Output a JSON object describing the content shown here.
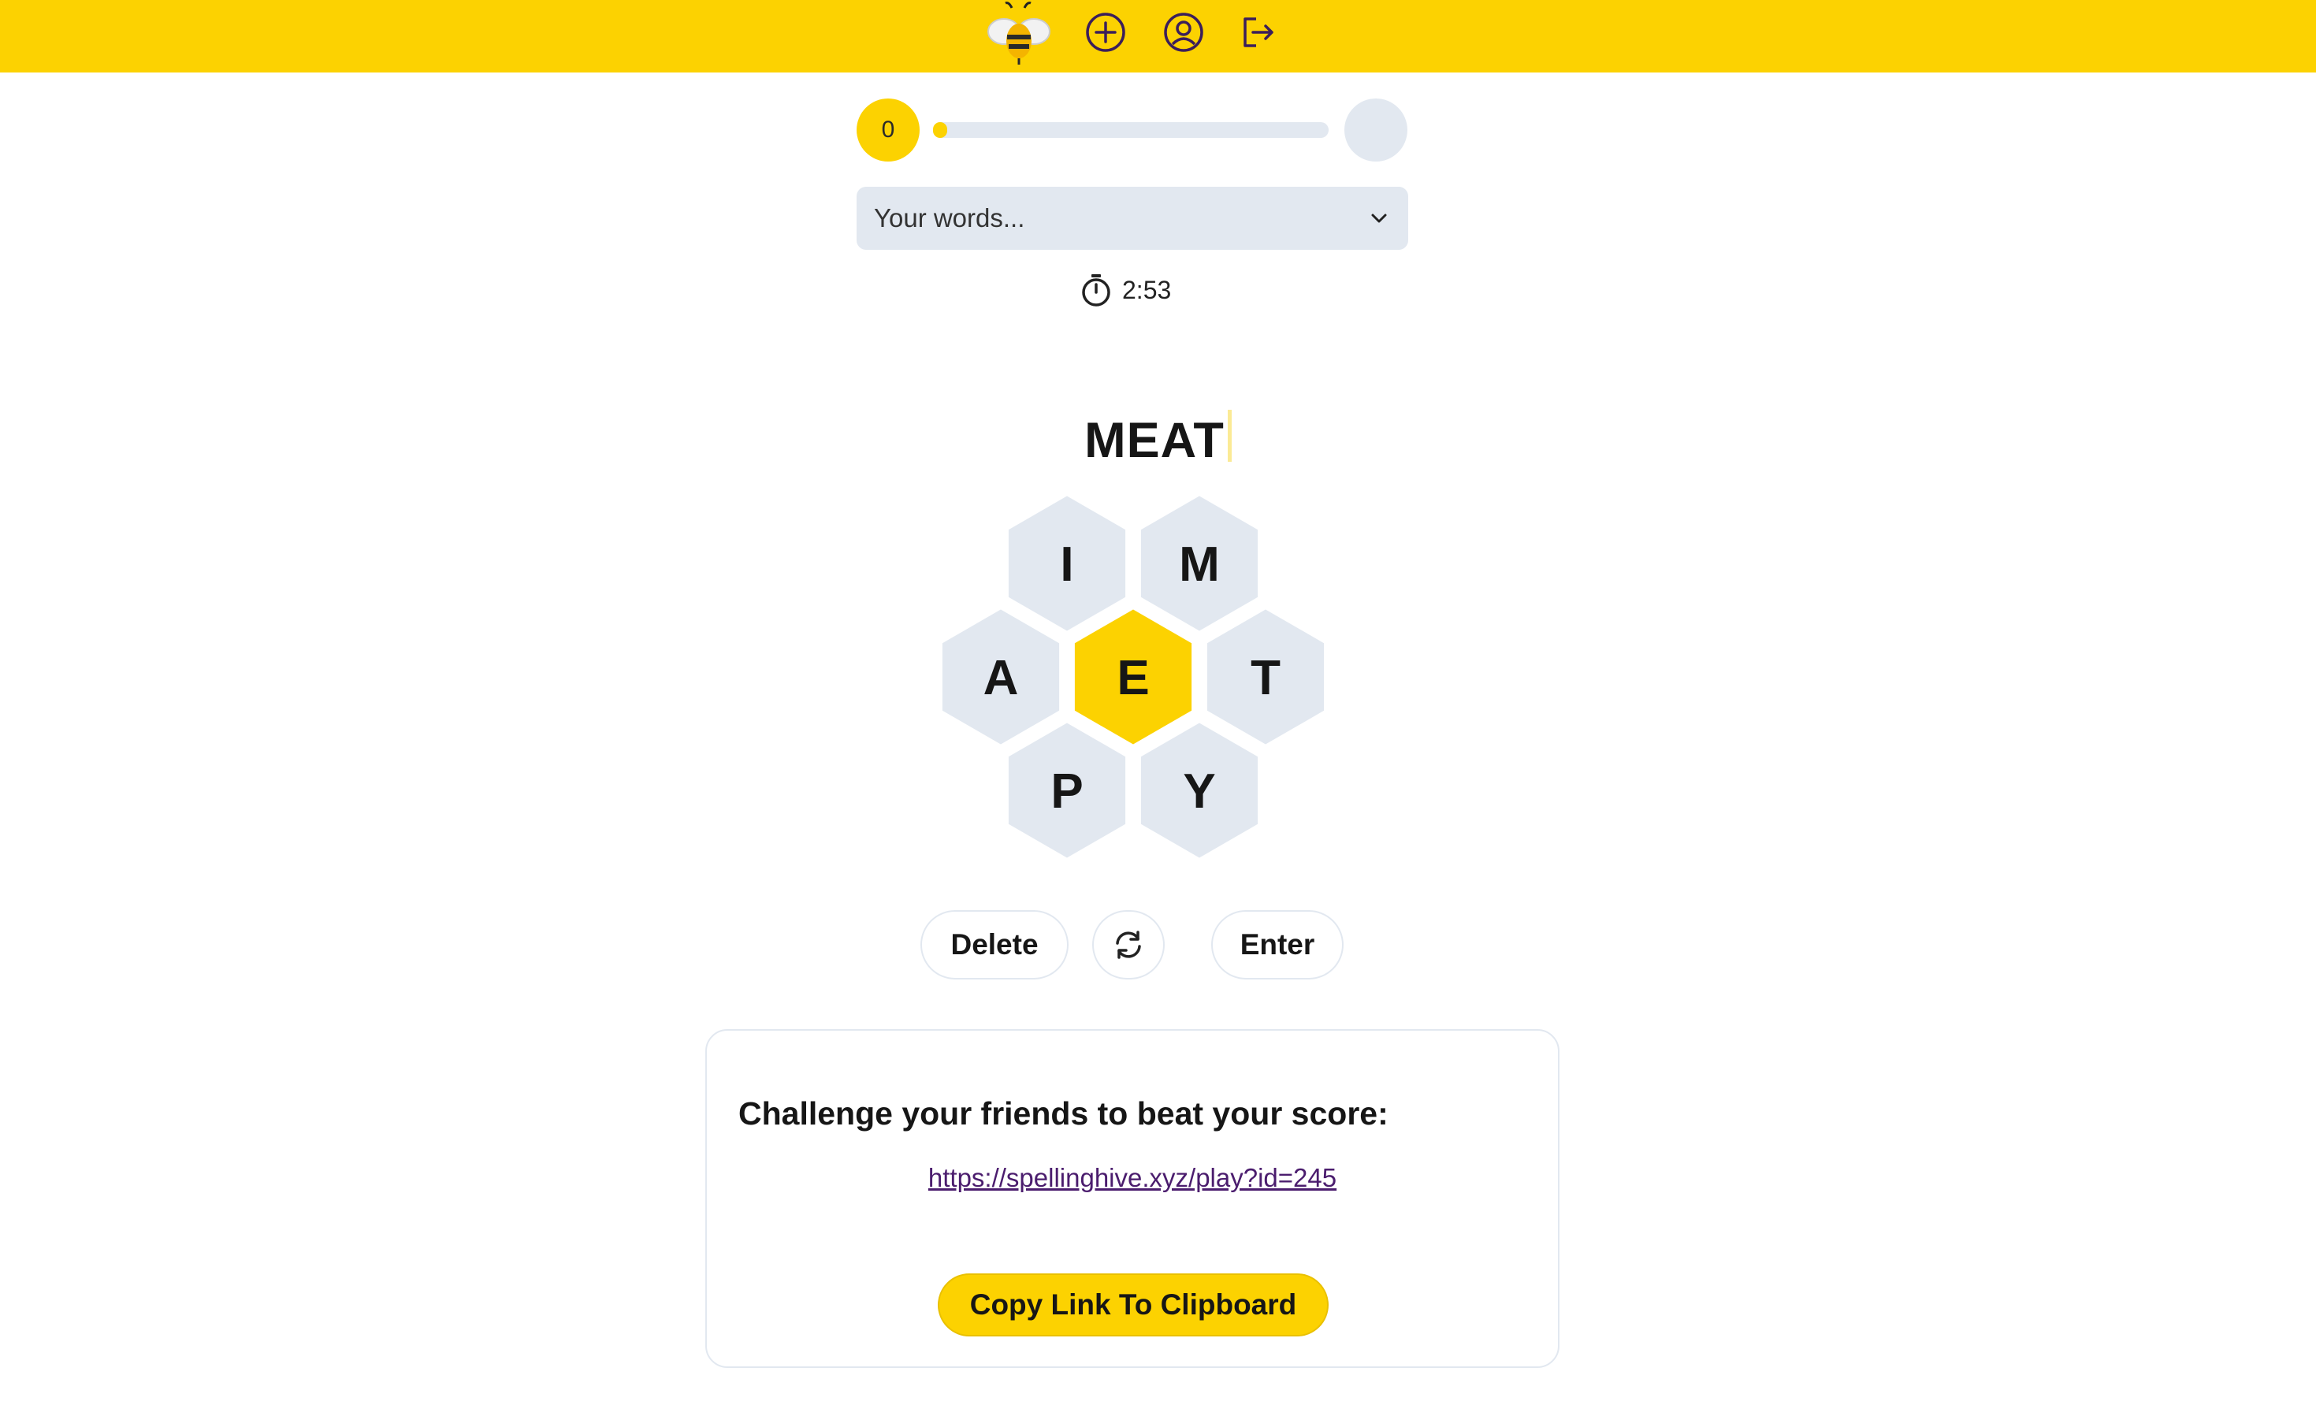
{
  "header": {
    "logo_icon": "bee-logo-icon",
    "new_game_icon": "plus-circle-icon",
    "profile_icon": "user-circle-icon",
    "logout_icon": "logout-icon",
    "background_color": "#FCD201"
  },
  "score": {
    "value": "0",
    "progress": 0.01
  },
  "words_dropdown": {
    "placeholder": "Your words...",
    "icon": "chevron-down-icon"
  },
  "timer": {
    "icon": "stopwatch-icon",
    "value": "2:53"
  },
  "current_word": "MEAT",
  "hive": {
    "center_letter": "E",
    "outer_letters": [
      "I",
      "M",
      "A",
      "T",
      "P",
      "Y"
    ],
    "center_color": "#FCD201",
    "outer_color": "#E2E8F0"
  },
  "controls": {
    "delete_label": "Delete",
    "shuffle_icon": "shuffle-icon",
    "enter_label": "Enter"
  },
  "share": {
    "heading": "Challenge your friends to beat your score:",
    "link": "https://spellinghive.xyz/play?id=245",
    "copy_label": "Copy Link To Clipboard"
  }
}
